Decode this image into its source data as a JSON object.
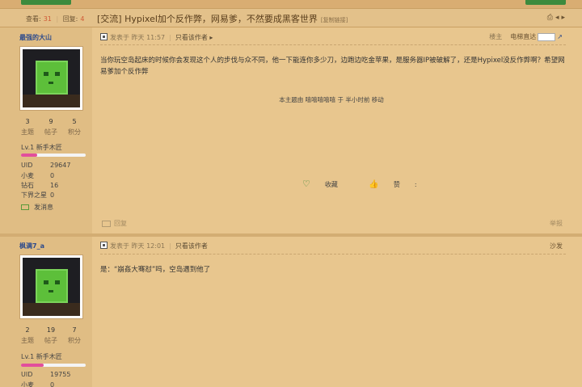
{
  "header": {
    "views_label": "查看:",
    "views": "31",
    "replies_label": "回复:",
    "replies": "4",
    "title": "[交流] Hypixel加个反作弊，网易爹，不然要成黑客世界",
    "copy_link": "[复制链接]",
    "icons": [
      "print-icon",
      "prev-arrow-icon",
      "next-arrow-icon"
    ]
  },
  "posts": [
    {
      "username": "最强的大山",
      "stats": [
        {
          "value": "3",
          "label": "主题"
        },
        {
          "value": "9",
          "label": "帖子"
        },
        {
          "value": "5",
          "label": "积分"
        }
      ],
      "level": "Lv.1 新手木匠",
      "level_progress": 0.25,
      "info": [
        {
          "key": "UID",
          "value": "29647"
        },
        {
          "key": "小麦",
          "value": "0"
        },
        {
          "key": "钻石",
          "value": "16"
        },
        {
          "key": "下界之星",
          "value": "0"
        }
      ],
      "send_message": "发消息",
      "posted_at": "发表于 昨天 11:57",
      "only_author": "只看该作者",
      "floor": "楼主",
      "jump_label": "电梯直达",
      "content": "当你玩空岛起床的时候你会发现这个人的步伐与众不同，他一下能连你多少刀，边跑边吃金苹果，是服务器IP被破解了，还是Hypixel没反作弊啊？希望网易爹加个反作弊",
      "moved_note": "本主题由 嘻嘻嘻嘻嘻 于 半小时前 移动",
      "favorite_label": "收藏",
      "like_label": "赞",
      "like_count": ":",
      "reply_label": "回复",
      "report_label": "举报"
    },
    {
      "username": "枫满7_a",
      "stats": [
        {
          "value": "2",
          "label": "主题"
        },
        {
          "value": "19",
          "label": "帖子"
        },
        {
          "value": "7",
          "label": "积分"
        }
      ],
      "level": "Lv.1 新手木匠",
      "level_progress": 0.35,
      "info": [
        {
          "key": "UID",
          "value": "19755"
        },
        {
          "key": "小麦",
          "value": "0"
        }
      ],
      "posted_at": "发表于 昨天 12:01",
      "only_author": "只看该作者",
      "floor": "沙发",
      "content": "是：“崩姦大骞怼”吗，空岛遇到他了"
    }
  ]
}
